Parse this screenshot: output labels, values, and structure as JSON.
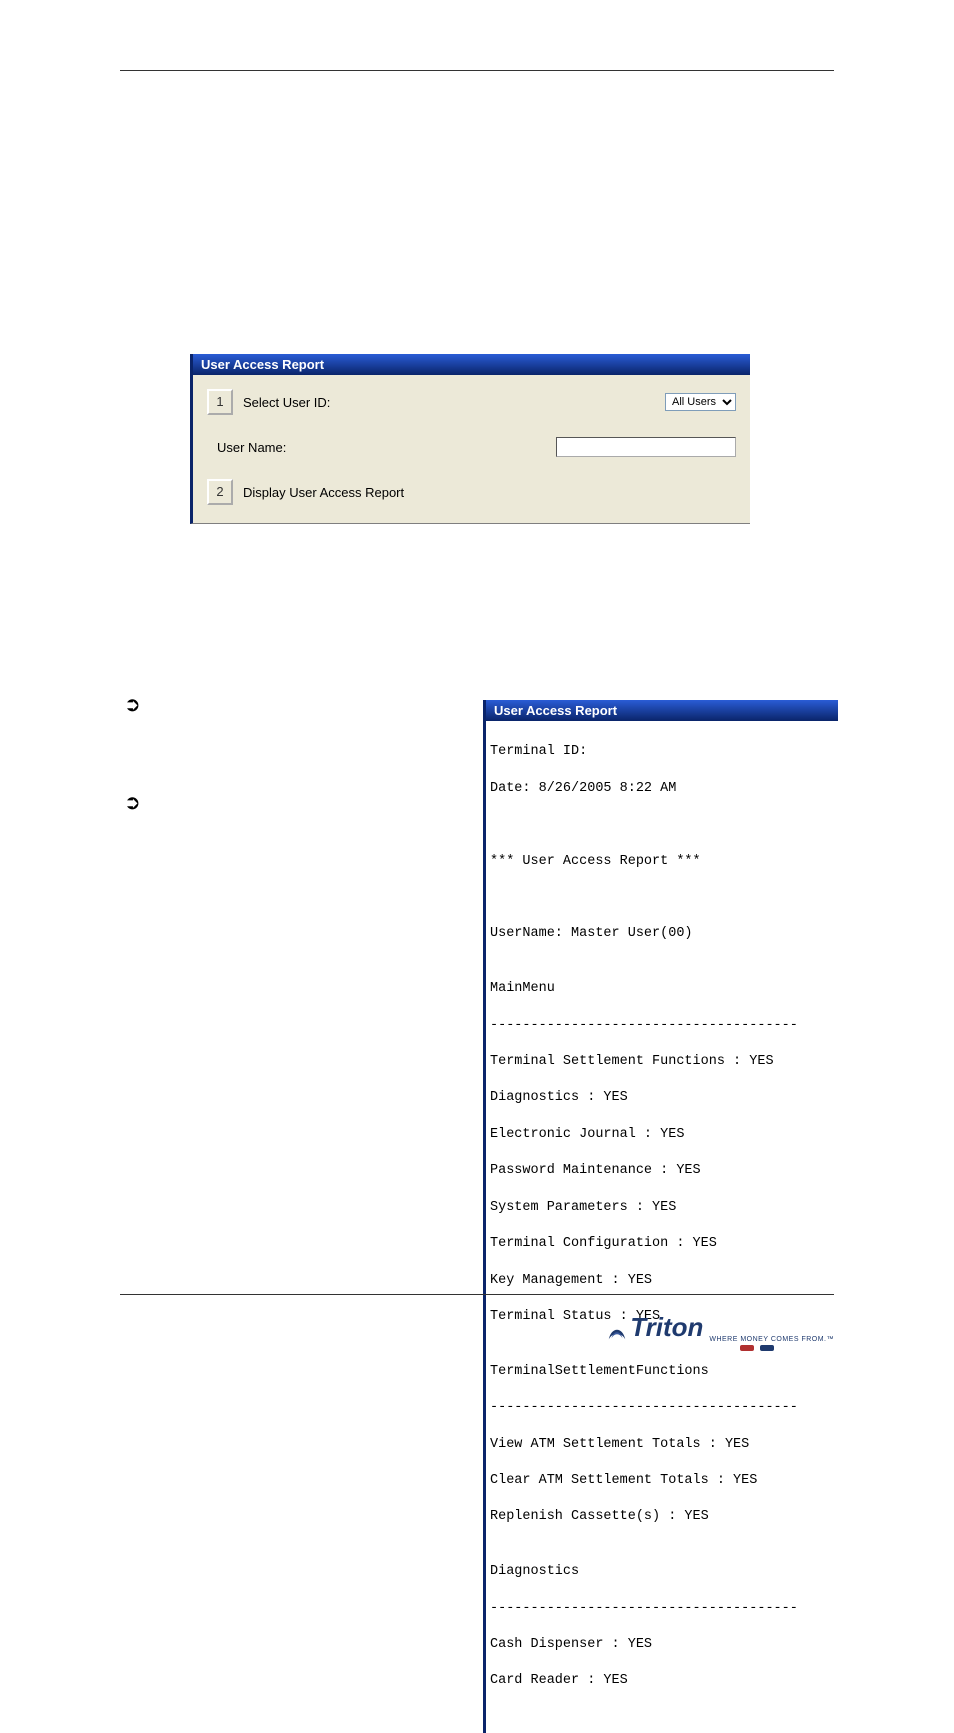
{
  "dialog1": {
    "title": "User Access Report",
    "select_user_id_label": "Select User ID:",
    "select_value": "All Users",
    "user_name_label": "User Name:",
    "display_report_label": "Display User Access Report",
    "btn1": "1",
    "btn2": "2"
  },
  "dialog2": {
    "title": "User Access Report",
    "lines": {
      "l0": "Terminal ID:",
      "l1": "Date: 8/26/2005 8:22 AM",
      "l2": "",
      "l3": "",
      "l4": "*** User Access Report ***",
      "l5": "",
      "l6": "",
      "l7": "UserName: Master User(00)",
      "l8": "",
      "l9": "MainMenu",
      "l10": "--------------------------------------",
      "l11": "Terminal Settlement Functions : YES",
      "l12": "Diagnostics : YES",
      "l13": "Electronic Journal : YES",
      "l14": "Password Maintenance : YES",
      "l15": "System Parameters : YES",
      "l16": "Terminal Configuration : YES",
      "l17": "Key Management : YES",
      "l18": "Terminal Status : YES",
      "l19": "",
      "l20": "TerminalSettlementFunctions",
      "l21": "--------------------------------------",
      "l22": "View ATM Settlement Totals : YES",
      "l23": "Clear ATM Settlement Totals : YES",
      "l24": "Replenish Cassette(s) : YES",
      "l25": "",
      "l26": "Diagnostics",
      "l27": "--------------------------------------",
      "l28": "Cash Dispenser : YES",
      "l29": "Card Reader : YES"
    }
  },
  "logo": {
    "name": "Triton",
    "tag": "WHERE MONEY COMES FROM.™"
  }
}
